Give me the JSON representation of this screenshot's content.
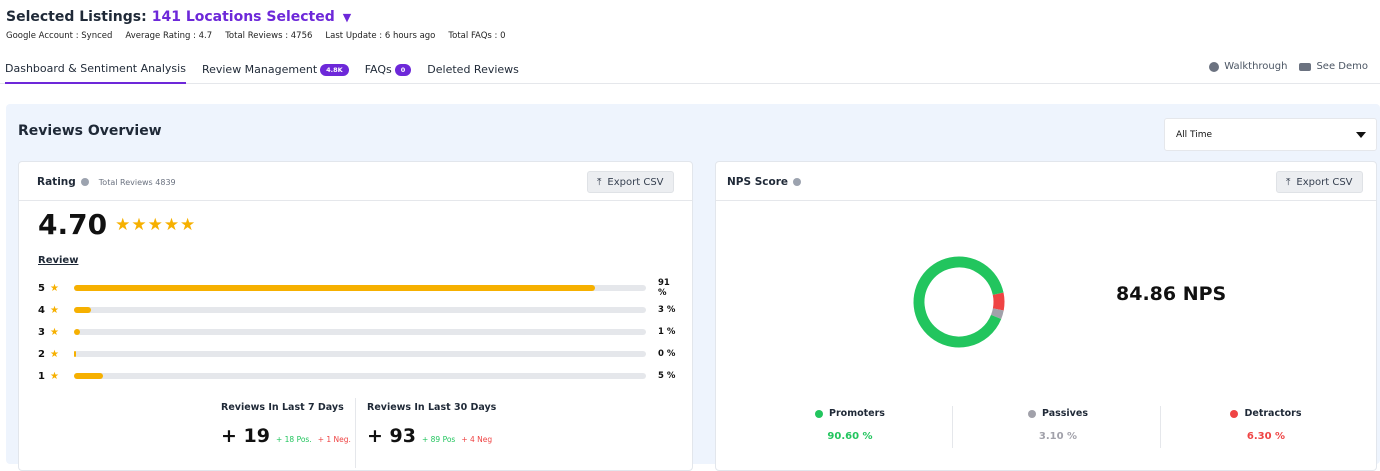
{
  "header": {
    "title_prefix": "Selected Listings:",
    "title_highlight": "141 Locations Selected",
    "meta": [
      "Google Account : Synced",
      "Average Rating : 4.7",
      "Total Reviews : 4756",
      "Last Update : 6 hours ago",
      "Total FAQs : 0"
    ]
  },
  "tabs": [
    {
      "label": "Dashboard & Sentiment Analysis",
      "badge": ""
    },
    {
      "label": "Review Management",
      "badge": "4.8K"
    },
    {
      "label": "FAQs",
      "badge": "0"
    },
    {
      "label": "Deleted Reviews",
      "badge": ""
    }
  ],
  "top_actions": {
    "walkthrough": "Walkthrough",
    "demo": "See Demo"
  },
  "overview": {
    "title": "Reviews Overview",
    "filter": "All Time"
  },
  "rating_card": {
    "title": "Rating",
    "total_note": "Total Reviews 4839",
    "export": "Export CSV",
    "average": "4.70",
    "stars": "★★★★★",
    "review_label": "Review",
    "bars": [
      {
        "label": "5",
        "percent": 91,
        "text": "91 %"
      },
      {
        "label": "4",
        "percent": 3,
        "text": "3 %"
      },
      {
        "label": "3",
        "percent": 1,
        "text": "1 %"
      },
      {
        "label": "2",
        "percent": 0,
        "text": "0 %"
      },
      {
        "label": "1",
        "percent": 5,
        "text": "5 %"
      }
    ],
    "last7": {
      "title": "Reviews In Last 7 Days",
      "value": "+ 19",
      "pos": "+ 18 Pos.",
      "neg": "+ 1 Neg."
    },
    "last30": {
      "title": "Reviews In Last 30 Days",
      "value": "+ 93",
      "pos": "+ 89 Pos",
      "neg": "+ 4 Neg"
    }
  },
  "nps_card": {
    "title": "NPS Score",
    "export": "Export CSV",
    "value": "84.86 NPS",
    "segments": [
      {
        "label": "Promoters",
        "value": "90.60 %",
        "percent": 90.6,
        "color": "#22c55e"
      },
      {
        "label": "Passives",
        "value": "3.10 %",
        "percent": 3.1,
        "color": "#a1a1aa"
      },
      {
        "label": "Detractors",
        "value": "6.30 %",
        "percent": 6.3,
        "color": "#ef4444"
      }
    ]
  }
}
